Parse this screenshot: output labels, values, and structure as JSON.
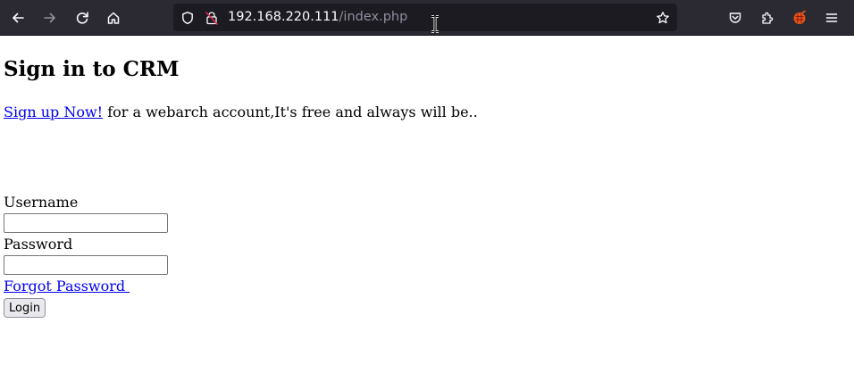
{
  "browser": {
    "url_host": "192.168.220.111",
    "url_path": "/index.php",
    "icons": {
      "back": "arrow-left-icon",
      "forward": "arrow-right-icon",
      "reload": "reload-icon",
      "home": "home-icon",
      "tracking": "shield-icon",
      "connection": "insecure-lock-icon",
      "bookmark": "star-icon",
      "pocket": "pocket-icon",
      "extensions": "puzzle-icon",
      "extension": "extension-icon",
      "menu": "hamburger-menu-icon"
    },
    "colors": {
      "toolbar": "#2b2a33",
      "urlbar": "#1c1b22",
      "insecure": "#e22850"
    }
  },
  "page": {
    "title": "Sign in to CRM",
    "signup_link": "Sign up Now!",
    "signup_text": " for a webarch account,It's free and always will be..",
    "username_label": "Username",
    "username_value": "",
    "password_label": "Password",
    "password_value": "",
    "forgot_link": "Forgot Password ",
    "login_button": "Login"
  }
}
